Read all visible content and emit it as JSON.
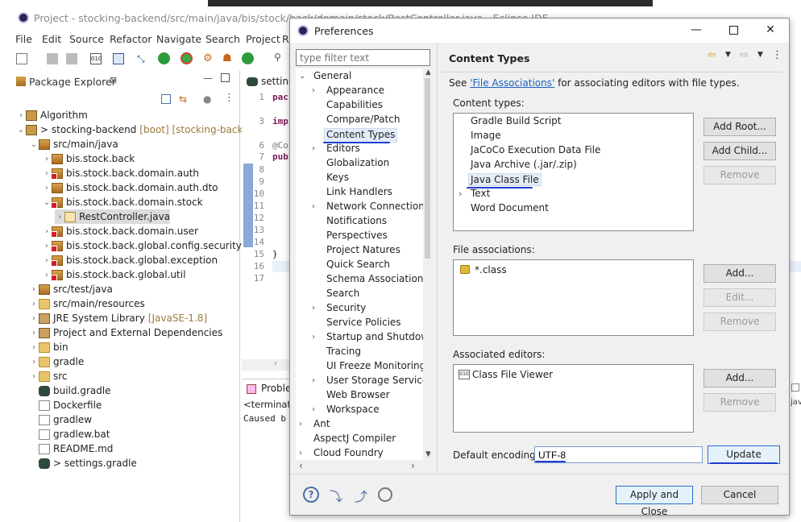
{
  "eclipse": {
    "title": "Project - stocking-backend/src/main/java/bis/stock/back/domain/stock/RestController.java - Eclipse IDE",
    "menu": [
      "File",
      "Edit",
      "Source",
      "Refactor",
      "Navigate",
      "Search",
      "Project",
      "R"
    ],
    "package_explorer": {
      "tab_label": "Package Explorer",
      "items": [
        {
          "label": "Algorithm",
          "extra": ""
        },
        {
          "label": "> stocking-backend",
          "extra": "[boot] [stocking-backend"
        },
        {
          "label": "src/main/java",
          "extra": ""
        },
        {
          "label": "bis.stock.back",
          "extra": ""
        },
        {
          "label": "bis.stock.back.domain.auth",
          "extra": ""
        },
        {
          "label": "bis.stock.back.domain.auth.dto",
          "extra": ""
        },
        {
          "label": "bis.stock.back.domain.stock",
          "extra": ""
        },
        {
          "label": "RestController.java",
          "extra": ""
        },
        {
          "label": "bis.stock.back.domain.user",
          "extra": ""
        },
        {
          "label": "bis.stock.back.global.config.security",
          "extra": ""
        },
        {
          "label": "bis.stock.back.global.exception",
          "extra": ""
        },
        {
          "label": "bis.stock.back.global.util",
          "extra": ""
        },
        {
          "label": "src/test/java",
          "extra": ""
        },
        {
          "label": "src/main/resources",
          "extra": ""
        },
        {
          "label": "JRE System Library",
          "extra": "[JavaSE-1.8]"
        },
        {
          "label": "Project and External Dependencies",
          "extra": ""
        },
        {
          "label": "bin",
          "extra": ""
        },
        {
          "label": "gradle",
          "extra": ""
        },
        {
          "label": "src",
          "extra": ""
        },
        {
          "label": "build.gradle",
          "extra": ""
        },
        {
          "label": "Dockerfile",
          "extra": ""
        },
        {
          "label": "gradlew",
          "extra": ""
        },
        {
          "label": "gradlew.bat",
          "extra": ""
        },
        {
          "label": "README.md",
          "extra": ""
        },
        {
          "label": "> settings.gradle",
          "extra": ""
        }
      ]
    },
    "editor": {
      "tab_label": "setting",
      "line_numbers": [
        "1",
        "3",
        "6",
        "7",
        "8",
        "9",
        "10",
        "11",
        "12",
        "13",
        "14",
        "15",
        "16",
        "17"
      ],
      "code": [
        "pac",
        "imp",
        "@Co",
        "pub",
        "}"
      ]
    },
    "console": {
      "tab_label": "Proble",
      "terminated": "<terminate",
      "caused": "Caused b"
    }
  },
  "preferences": {
    "title": "Preferences",
    "filter_placeholder": "type filter text",
    "tree": [
      {
        "label": "General",
        "arrow": "v"
      },
      {
        "label": "Appearance",
        "arrow": ">"
      },
      {
        "label": "Capabilities",
        "arrow": ""
      },
      {
        "label": "Compare/Patch",
        "arrow": ""
      },
      {
        "label": "Content Types",
        "arrow": ""
      },
      {
        "label": "Editors",
        "arrow": ">"
      },
      {
        "label": "Globalization",
        "arrow": ""
      },
      {
        "label": "Keys",
        "arrow": ""
      },
      {
        "label": "Link Handlers",
        "arrow": ""
      },
      {
        "label": "Network Connection",
        "arrow": ">"
      },
      {
        "label": "Notifications",
        "arrow": ""
      },
      {
        "label": "Perspectives",
        "arrow": ""
      },
      {
        "label": "Project Natures",
        "arrow": ""
      },
      {
        "label": "Quick Search",
        "arrow": ""
      },
      {
        "label": "Schema Associations",
        "arrow": ""
      },
      {
        "label": "Search",
        "arrow": ""
      },
      {
        "label": "Security",
        "arrow": ">"
      },
      {
        "label": "Service Policies",
        "arrow": ""
      },
      {
        "label": "Startup and Shutdow",
        "arrow": ">"
      },
      {
        "label": "Tracing",
        "arrow": ""
      },
      {
        "label": "UI Freeze Monitoring",
        "arrow": ""
      },
      {
        "label": "User Storage Service",
        "arrow": ">"
      },
      {
        "label": "Web Browser",
        "arrow": ""
      },
      {
        "label": "Workspace",
        "arrow": ">"
      },
      {
        "label": "Ant",
        "arrow": ">"
      },
      {
        "label": "AspectJ Compiler",
        "arrow": ""
      },
      {
        "label": "Cloud Foundry",
        "arrow": ">"
      }
    ],
    "page_title": "Content Types",
    "see_prefix": "See ",
    "see_link": "'File Associations'",
    "see_suffix": " for associating editors with file types.",
    "content_types_label": "Content types:",
    "content_types": [
      "Gradle Build Script",
      "Image",
      "JaCoCo Execution Data File",
      "Java Archive (.jar/.zip)",
      "Java Class File",
      "Text",
      "Word Document"
    ],
    "content_type_buttons": {
      "add_root": "Add Root...",
      "add_child": "Add Child...",
      "remove": "Remove"
    },
    "file_associations_label": "File associations:",
    "file_associations": [
      "*.class"
    ],
    "file_assoc_buttons": {
      "add": "Add...",
      "edit": "Edit...",
      "remove": "Remove"
    },
    "associated_editors_label": "Associated editors:",
    "associated_editors": [
      "Class File Viewer"
    ],
    "editor_buttons": {
      "add": "Add...",
      "remove": "Remove"
    },
    "default_encoding_label": "Default encoding:",
    "default_encoding_value": "UTF-8",
    "update_button": "Update",
    "apply_close_button": "Apply and Close",
    "cancel_button": "Cancel"
  },
  "colors": {
    "annotation": "#1f3fd0",
    "link": "#1a5fc4",
    "selection": "#e4ecf7"
  }
}
